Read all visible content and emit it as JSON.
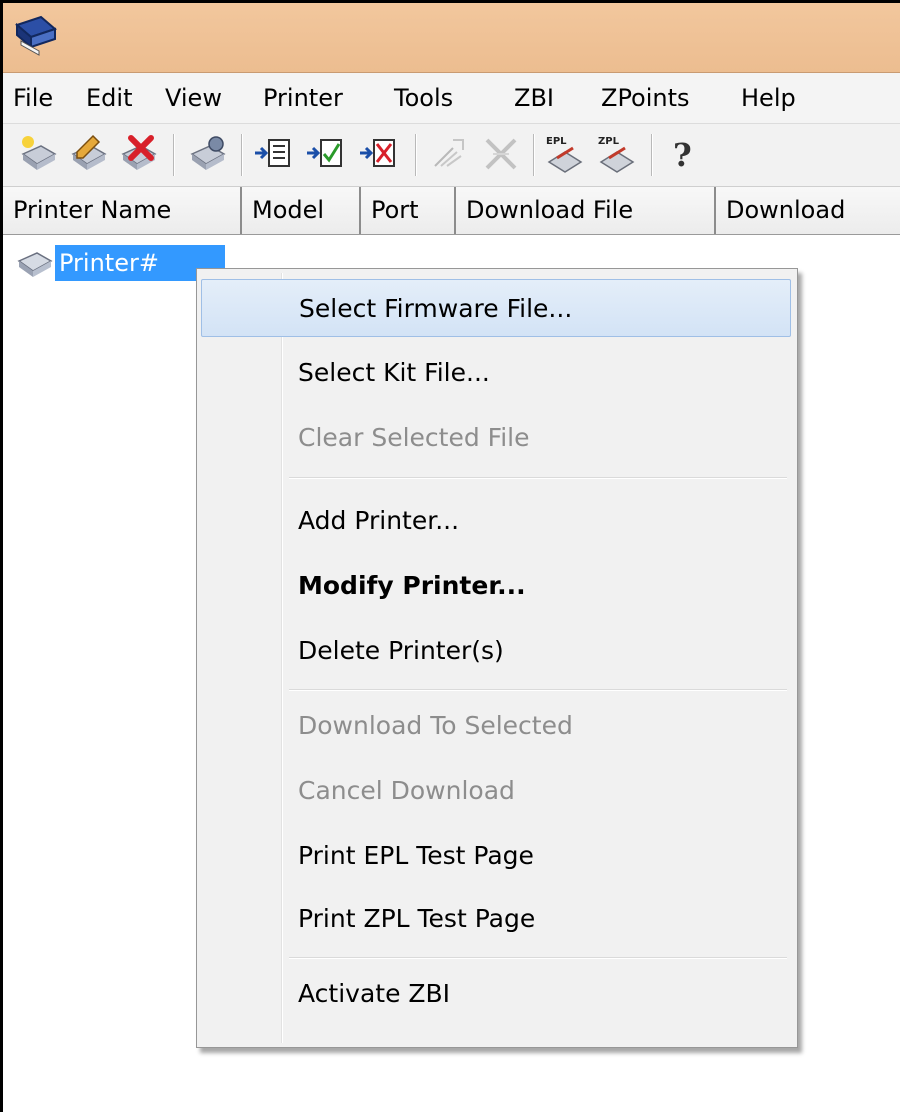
{
  "menubar": {
    "items": [
      "File",
      "Edit",
      "View",
      "Printer",
      "Tools",
      "ZBI",
      "ZPoints",
      "Help"
    ]
  },
  "toolbar": {
    "buttons": [
      "new-printer-icon",
      "edit-printer-icon",
      "delete-printer-icon",
      "printer-properties-icon",
      "select-file-icon",
      "select-kit-icon",
      "clear-file-icon",
      "download-icon",
      "cancel-download-icon",
      "epl-test-icon",
      "zpl-test-icon",
      "help-icon"
    ],
    "epl_label": "EPL",
    "zpl_label": "ZPL",
    "help_glyph": "?"
  },
  "columns": [
    "Printer Name",
    "Model",
    "Port",
    "Download File",
    "Download"
  ],
  "tree": {
    "printer_label": "Printer#"
  },
  "context_menu": {
    "items": [
      {
        "label": "Select Firmware File...",
        "state": "hover"
      },
      {
        "label": "Select Kit File...",
        "state": "normal"
      },
      {
        "label": "Clear Selected File",
        "state": "disabled"
      },
      {
        "label": "Add Printer...",
        "state": "normal"
      },
      {
        "label": "Modify Printer...",
        "state": "bold"
      },
      {
        "label": "Delete Printer(s)",
        "state": "normal"
      },
      {
        "label": "Download To Selected",
        "state": "disabled"
      },
      {
        "label": "Cancel Download",
        "state": "disabled"
      },
      {
        "label": "Print EPL Test Page",
        "state": "normal"
      },
      {
        "label": "Print ZPL Test Page",
        "state": "normal"
      },
      {
        "label": "Activate ZBI",
        "state": "normal"
      }
    ]
  },
  "colors": {
    "titlebar": "#ecbd90",
    "selection": "#3399ff",
    "menu_hover": "#d3e3f6",
    "disabled_text": "#8d8d8d"
  }
}
